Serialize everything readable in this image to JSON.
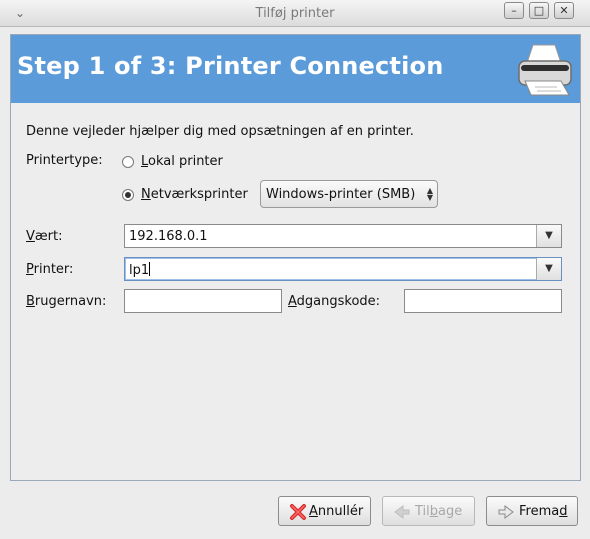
{
  "window": {
    "title": "Tilføj printer",
    "menu_glyph": "⌄",
    "controls": {
      "minimize": "–",
      "maximize": "□",
      "close": "✕"
    }
  },
  "banner": {
    "title": "Step 1 of 3: Printer Connection",
    "icon": "printer-icon",
    "color": "#5b9bd9"
  },
  "intro_text": "Denne vejleder hjælper dig med opsætningen af en printer.",
  "printertype": {
    "label": "Printertype:",
    "local": {
      "accel": "L",
      "rest": "okal printer",
      "checked": false
    },
    "network": {
      "accel": "N",
      "rest": "etværksprinter",
      "checked": true
    },
    "protocol_select": {
      "value": "Windows-printer (SMB)"
    }
  },
  "fields": {
    "host": {
      "accel": "V",
      "rest": "ært:",
      "value": "192.168.0.1"
    },
    "printer": {
      "accel": "P",
      "rest": "rinter:",
      "value": "lp1"
    },
    "username": {
      "accel": "B",
      "rest": "rugernavn:",
      "value": ""
    },
    "password": {
      "accel": "A",
      "rest": "dgangskode:",
      "value": ""
    }
  },
  "buttons": {
    "cancel": {
      "accel": "A",
      "rest": "nnullér",
      "icon": "cancel-x-icon"
    },
    "back": {
      "pre": "Til",
      "accel": "b",
      "rest": "age",
      "enabled": false,
      "icon": "back-arrow-icon"
    },
    "forward": {
      "pre": "Frema",
      "accel": "d",
      "rest": "",
      "icon": "forward-arrow-icon"
    }
  }
}
